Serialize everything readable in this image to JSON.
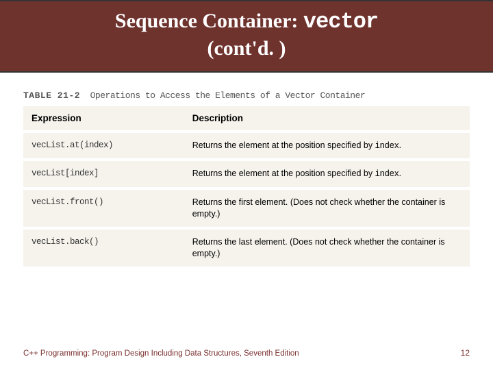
{
  "title": {
    "pre": "Sequence Container: ",
    "code": "vector",
    "sub": "(cont'd. )"
  },
  "table_caption_prefix": "TABLE 21-2",
  "table_caption": "Operations to Access the Elements of a Vector Container",
  "headers": {
    "expr": "Expression",
    "desc": "Description"
  },
  "rows": [
    {
      "expr": "vecList.at(index)",
      "desc_html": "Returns the element at the position specified by <span class=\"code\">index</span>."
    },
    {
      "expr": "vecList[index]",
      "desc_html": "Returns the element at the position specified by <span class=\"code\">index</span>."
    },
    {
      "expr": "vecList.front()",
      "desc_html": "Returns the first element. (Does not check whether the container is empty.)"
    },
    {
      "expr": "vecList.back()",
      "desc_html": "Returns the last element. (Does not check whether the container is empty.)"
    }
  ],
  "footer": {
    "text": "C++ Programming: Program Design Including Data Structures, Seventh Edition",
    "page": "12"
  }
}
